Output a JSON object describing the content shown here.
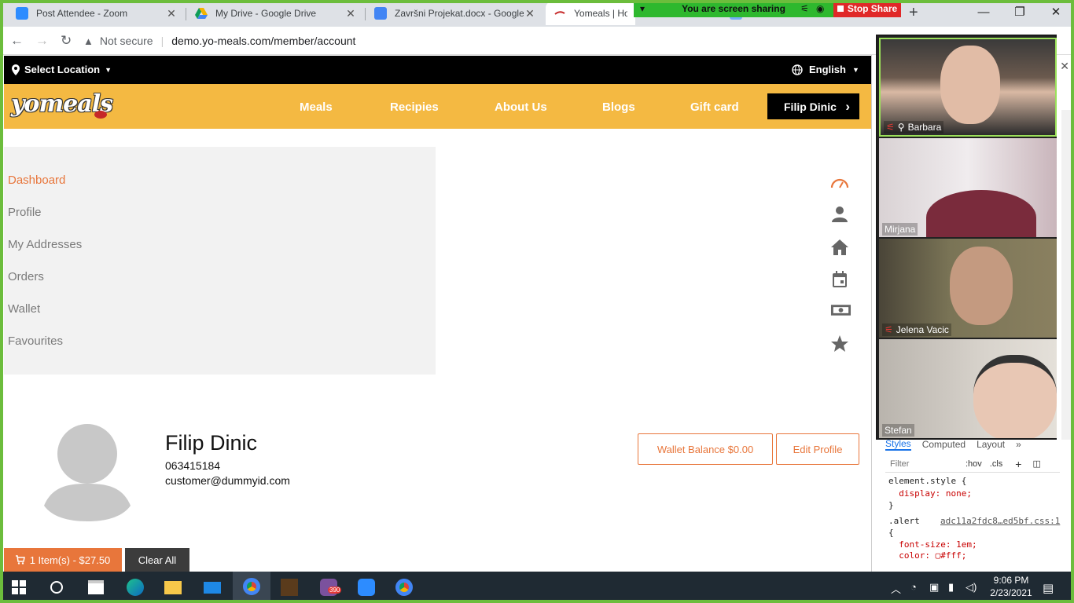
{
  "browser": {
    "tabs": [
      {
        "title": "Post Attendee - Zoom",
        "close": "✕"
      },
      {
        "title": "My Drive - Google Drive",
        "close": "✕"
      },
      {
        "title": "Završni Projekat.docx - Google",
        "close": "✕"
      },
      {
        "title": "Yomeals | Hom",
        "close": ""
      }
    ],
    "new_tab": "+",
    "not_secure": "Not secure",
    "url": "demo.yo-meals.com/member/account"
  },
  "zoom": {
    "sharing_text": "You are screen sharing",
    "stop_share": "Stop Share",
    "participants": [
      {
        "name": "Barbara"
      },
      {
        "name": "Mirjana"
      },
      {
        "name": "Jelena Vacic"
      },
      {
        "name": "Stefan"
      }
    ]
  },
  "site": {
    "location": "Select Location",
    "language": "English",
    "logo": "yomeals",
    "nav": [
      "Meals",
      "Recipies",
      "About Us",
      "Blogs",
      "Gift card"
    ],
    "user_button": "Filip Dinic",
    "menu": [
      "Dashboard",
      "Profile",
      "My Addresses",
      "Orders",
      "Wallet",
      "Favourites"
    ],
    "menu_icons": [
      "speedometer-icon",
      "user-icon",
      "home-icon",
      "calendar-icon",
      "money-icon",
      "star-icon"
    ],
    "profile": {
      "name": "Filip Dinic",
      "phone": "063415184",
      "email": "customer@dummyid.com"
    },
    "wallet_button": "Wallet Balance $0.00",
    "edit_button": "Edit Profile",
    "cart_button": "1 Item(s) - $27.50",
    "clear_button": "Clear All",
    "colors": {
      "accent": "#e8763b",
      "nav": "#f4b942",
      "top": "#000000"
    }
  },
  "devtools": {
    "tabs": [
      "Styles",
      "Computed",
      "Layout",
      "»"
    ],
    "filter_placeholder": "Filter",
    "hov": ":hov",
    "cls": ".cls",
    "code": [
      "element.style {",
      "  display: none;",
      "}",
      ".alert",
      "{",
      "  font-size: 1em;",
      "  color: ▢#fff;"
    ],
    "source_link": "adc11a2fdc8…ed5bf.css:1"
  },
  "taskbar": {
    "time": "9:06 PM",
    "date": "2/23/2021",
    "badge": "390"
  }
}
